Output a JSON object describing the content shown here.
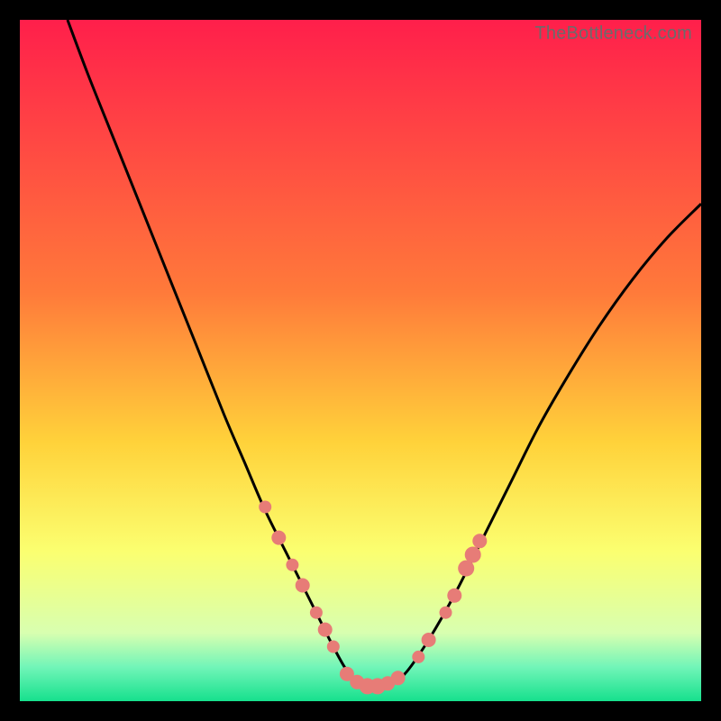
{
  "watermark": "TheBottleneck.com",
  "colors": {
    "bg_black": "#000000",
    "curve": "#000000",
    "marker_fill": "#e77c77",
    "marker_stroke": "#c85d58",
    "grad_top": "#ff1f4b",
    "grad_mid1": "#ff7a3a",
    "grad_mid2": "#ffd23a",
    "grad_yzone": "#fbff70",
    "grad_low1": "#d8ffb0",
    "grad_low2": "#71f5b8",
    "grad_bottom": "#16e08d"
  },
  "chart_data": {
    "type": "line",
    "title": "",
    "xlabel": "",
    "ylabel": "",
    "xlim": [
      0,
      100
    ],
    "ylim": [
      0,
      100
    ],
    "background_gradient_stops": [
      {
        "offset": 0.0,
        "color_key": "grad_top"
      },
      {
        "offset": 0.4,
        "color_key": "grad_mid1"
      },
      {
        "offset": 0.62,
        "color_key": "grad_mid2"
      },
      {
        "offset": 0.78,
        "color_key": "grad_yzone"
      },
      {
        "offset": 0.9,
        "color_key": "grad_low1"
      },
      {
        "offset": 0.95,
        "color_key": "grad_low2"
      },
      {
        "offset": 1.0,
        "color_key": "grad_bottom"
      }
    ],
    "series": [
      {
        "name": "bottleneck-curve",
        "x": [
          7,
          10,
          14,
          18,
          22,
          26,
          30,
          33,
          36,
          39,
          41.5,
          44,
          46,
          48,
          50,
          52,
          54,
          56.5,
          60,
          64,
          68,
          72,
          76,
          80,
          85,
          90,
          95,
          100
        ],
        "y": [
          100,
          92,
          82,
          72,
          62,
          52,
          42,
          35,
          28,
          22,
          17,
          12,
          8,
          4.5,
          2.5,
          2.0,
          2.5,
          4,
          9,
          16,
          24,
          32,
          40,
          47,
          55,
          62,
          68,
          73
        ]
      }
    ],
    "markers": [
      {
        "name": "left-upper-1",
        "x": 36.0,
        "y": 28.5,
        "r": 7
      },
      {
        "name": "left-upper-2",
        "x": 38.0,
        "y": 24.0,
        "r": 8
      },
      {
        "name": "left-mid-1",
        "x": 40.0,
        "y": 20.0,
        "r": 7
      },
      {
        "name": "left-mid-2",
        "x": 41.5,
        "y": 17.0,
        "r": 8
      },
      {
        "name": "left-low-1",
        "x": 43.5,
        "y": 13.0,
        "r": 7
      },
      {
        "name": "left-low-2",
        "x": 44.8,
        "y": 10.5,
        "r": 8
      },
      {
        "name": "left-low-3",
        "x": 46.0,
        "y": 8.0,
        "r": 7
      },
      {
        "name": "bottom-1",
        "x": 48.0,
        "y": 4.0,
        "r": 8
      },
      {
        "name": "bottom-2",
        "x": 49.5,
        "y": 2.8,
        "r": 8
      },
      {
        "name": "bottom-3",
        "x": 51.0,
        "y": 2.2,
        "r": 9
      },
      {
        "name": "bottom-4",
        "x": 52.5,
        "y": 2.2,
        "r": 9
      },
      {
        "name": "bottom-5",
        "x": 54.0,
        "y": 2.6,
        "r": 8
      },
      {
        "name": "bottom-6",
        "x": 55.5,
        "y": 3.4,
        "r": 8
      },
      {
        "name": "right-low-1",
        "x": 58.5,
        "y": 6.5,
        "r": 7
      },
      {
        "name": "right-low-2",
        "x": 60.0,
        "y": 9.0,
        "r": 8
      },
      {
        "name": "right-mid-1",
        "x": 62.5,
        "y": 13.0,
        "r": 7
      },
      {
        "name": "right-mid-2",
        "x": 63.8,
        "y": 15.5,
        "r": 8
      },
      {
        "name": "right-upper-1",
        "x": 65.5,
        "y": 19.5,
        "r": 9
      },
      {
        "name": "right-upper-2",
        "x": 66.5,
        "y": 21.5,
        "r": 9
      },
      {
        "name": "right-upper-3",
        "x": 67.5,
        "y": 23.5,
        "r": 8
      }
    ]
  }
}
